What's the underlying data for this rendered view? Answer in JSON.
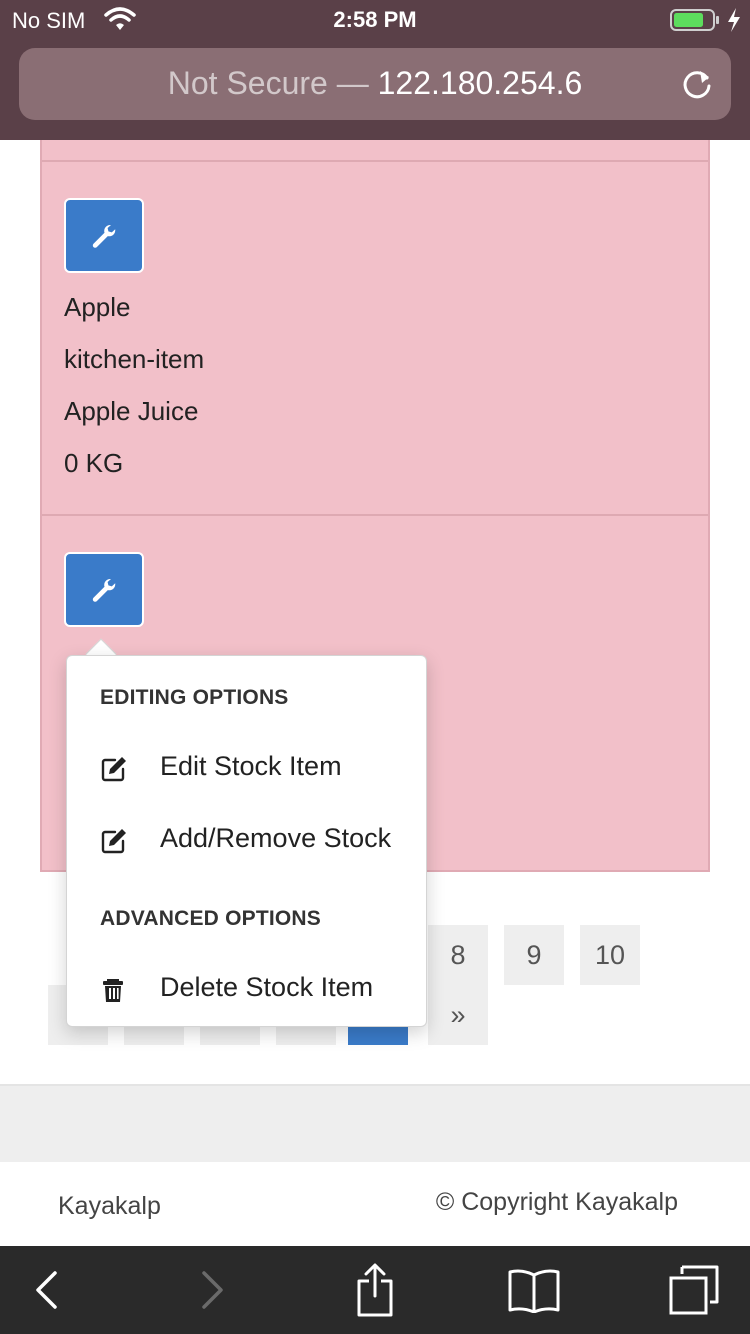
{
  "statusbar": {
    "carrier": "No SIM",
    "time": "2:58 PM"
  },
  "url_bar": {
    "security": "Not Secure —",
    "host": "122.180.254.6"
  },
  "rows": [
    {
      "name": "Apple",
      "category": "kitchen-item",
      "description": "Apple Juice",
      "quantity": "0 KG"
    }
  ],
  "pagination": {
    "top_pages": [
      "8",
      "9",
      "10"
    ],
    "next": "»"
  },
  "dropdown": {
    "editing_header": "EDITING OPTIONS",
    "edit_item": "Edit Stock Item",
    "add_remove": "Add/Remove Stock",
    "advanced_header": "ADVANCED OPTIONS",
    "delete_item": "Delete Stock Item"
  },
  "footer": {
    "brand": "Kayakalp",
    "copyright": "© Copyright Kayakalp"
  },
  "colors": {
    "row_background": "#f2c0c9",
    "button_blue": "#3a7bc9",
    "chrome_tint": "#5a4048"
  }
}
